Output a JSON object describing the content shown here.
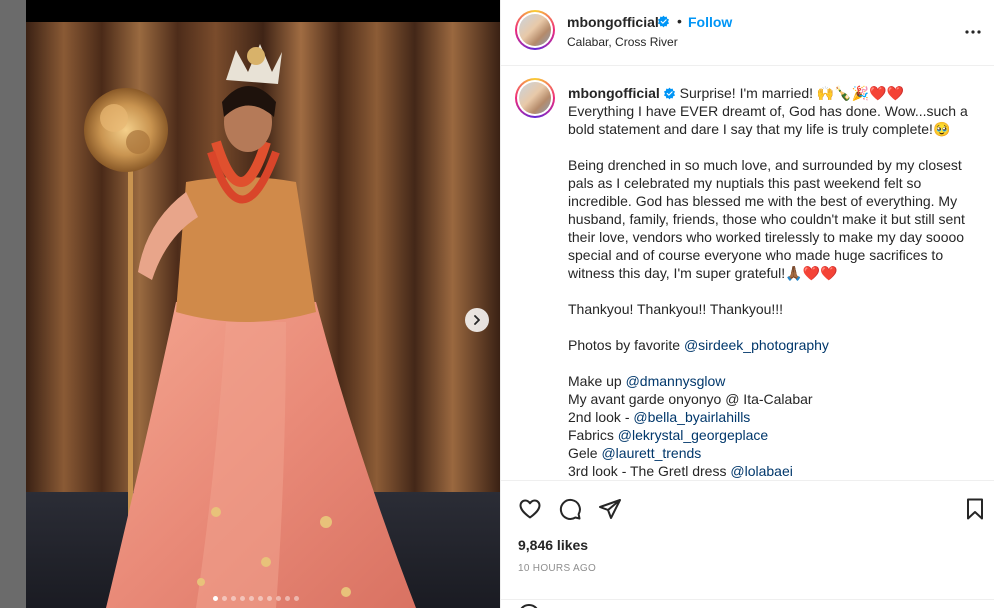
{
  "header": {
    "username": "mbongofficial",
    "separator": "•",
    "follow_label": "Follow",
    "location": "Calabar, Cross River"
  },
  "caption": {
    "username": "mbongofficial",
    "intro": "Surprise! I'm married! 🙌🍾🎉❤️❤️",
    "line2": "Everything I have EVER dreamt of, God has done. Wow...such a bold statement and dare I say that my life is truly complete!🥹",
    "para2": "Being drenched in so much love, and surrounded by my closest pals as I celebrated my nuptials this past weekend felt so incredible. God has blessed me with the best of everything. My husband, family, friends, those who couldn't make it but still sent their love, vendors who worked tirelessly to make my day soooo special and of course everyone who made huge sacrifices to witness this day, I'm super grateful!🙏🏾❤️❤️",
    "para3": "Thankyou! Thankyou!! Thankyou!!!",
    "photos_prefix": "Photos by favorite",
    "photos_mention": "@sirdeek_photography",
    "makeup_prefix": "Make up",
    "makeup_mention": "@dmannysglow",
    "avant": "My avant garde onyonyo @ Ita-Calabar",
    "look2_prefix": "2nd look -",
    "look2_mention": "@bella_byairlahills",
    "fabrics_prefix": "Fabrics",
    "fabrics_mention": "@lekrystal_georgeplace",
    "gele_prefix": "Gele",
    "gele_mention": "@laurett_trends",
    "look3_prefix": "3rd look - The Gretl dress",
    "look3_mention": "@lolabaei"
  },
  "stats": {
    "likes": "9,846 likes",
    "time": "10 HOURS AGO"
  },
  "carousel": {
    "slide_count": 10,
    "active_index": 0
  },
  "icons": {
    "verified": "verified-badge-icon",
    "more": "more-options-icon",
    "like": "heart-icon",
    "comment": "comment-icon",
    "share": "share-icon",
    "save": "bookmark-icon",
    "next": "chevron-right-icon"
  },
  "colors": {
    "link": "#0095f6",
    "mention": "#00376b",
    "muted": "#8e8e8e"
  }
}
